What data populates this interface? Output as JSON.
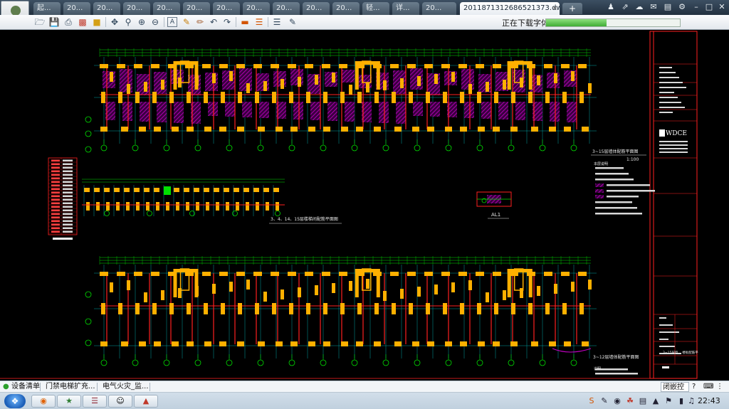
{
  "tabs": [
    {
      "label": "起..."
    },
    {
      "label": "20..."
    },
    {
      "label": "20..."
    },
    {
      "label": "20..."
    },
    {
      "label": "20..."
    },
    {
      "label": "20..."
    },
    {
      "label": "20..."
    },
    {
      "label": "20..."
    },
    {
      "label": "20..."
    },
    {
      "label": "20..."
    },
    {
      "label": "20..."
    },
    {
      "label": "轻..."
    },
    {
      "label": "详..."
    },
    {
      "label": "20..."
    }
  ],
  "active_tab": {
    "label": "2011871312686521373.dwg",
    "close": "×"
  },
  "tab_add": "+",
  "download_status": "正在下载字体...",
  "download_progress": 0.45,
  "drawing": {
    "plan_upper_title": "3~15层墙体配筋平面图",
    "plan_upper_scale": "1:100",
    "plan_mid_title": "3、4、14、15层楼梯间配筋平面图",
    "plan_lower_title": "3~12层墙体配筋平面图",
    "detail_label": "AL1",
    "notes_title": "本层说明",
    "notes_footer": "说明",
    "titleblock_logo": "WDCE",
    "titleblock_drawing_name": "3~15层墙 、楼板配筋平",
    "layer_colors": {
      "grid": "#00e000",
      "walls": "#ffb000",
      "hatch": "#c800c8",
      "beams": "#ff2020",
      "dims": "#00c8c8",
      "frame": "#ff2020"
    }
  },
  "taskbar": {
    "items": [
      "设备清单",
      "门禁电梯扩充...",
      "电气火灾_监..."
    ],
    "lang": "闭嵌控",
    "time": "22:43"
  }
}
